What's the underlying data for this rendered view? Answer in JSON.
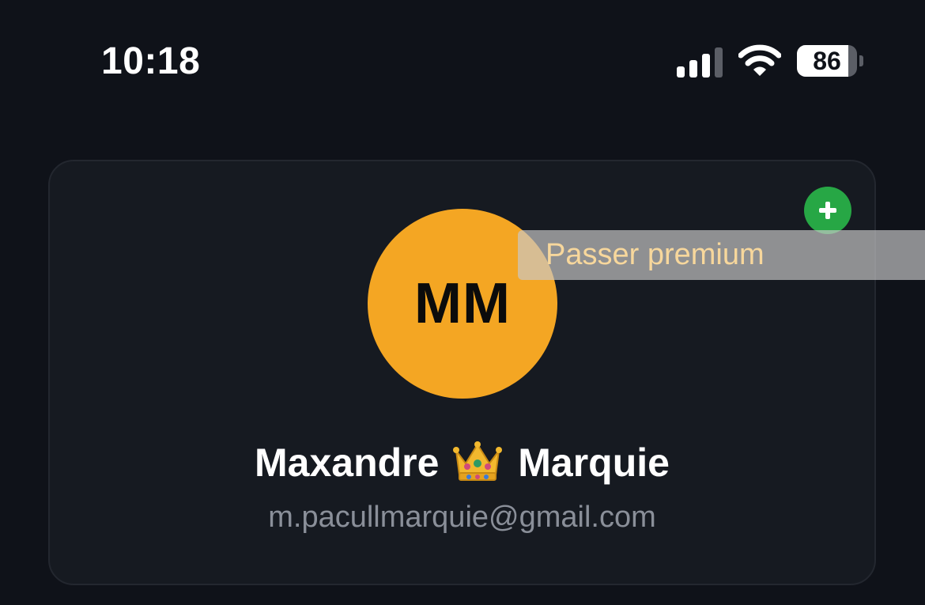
{
  "status_bar": {
    "time": "10:18",
    "battery_level": "86",
    "battery_fraction": 0.86,
    "icons": [
      "signal-icon",
      "wifi-icon",
      "battery-icon"
    ]
  },
  "profile": {
    "initials": "MM",
    "first_name": "Maxandre",
    "last_name": "Marquie",
    "name_icon": "crown-icon",
    "email": "m.pacullmarquie@gmail.com",
    "add_icon": "plus-icon",
    "premium_label": "Passer premium"
  },
  "colors": {
    "background": "#0f1219",
    "card": "#161a21",
    "avatar": "#f4a623",
    "add_button": "#27a745",
    "premium_text": "#f7d79c",
    "email_text": "#8a8f99"
  }
}
